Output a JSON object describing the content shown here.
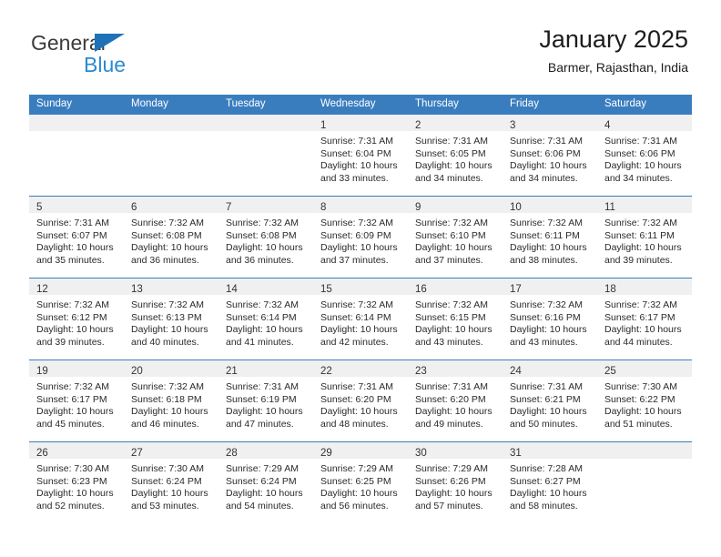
{
  "brand": {
    "line1": "General",
    "line2": "Blue",
    "line1_color": "#3b3b3b",
    "line2_color": "#2b8ad1",
    "triangle_color": "#1f72b8"
  },
  "header": {
    "title": "January 2025",
    "subtitle": "Barmer, Rajasthan, India"
  },
  "theme": {
    "header_blue": "#3a7dbf",
    "daynum_band": "#f0f0f0",
    "cell_bg": "#ffffff",
    "text": "#2a2a2a"
  },
  "weekdays": [
    "Sunday",
    "Monday",
    "Tuesday",
    "Wednesday",
    "Thursday",
    "Friday",
    "Saturday"
  ],
  "weeks": [
    [
      {
        "day": "",
        "sunrise": "",
        "sunset": "",
        "daylight_1": "",
        "daylight_2": ""
      },
      {
        "day": "",
        "sunrise": "",
        "sunset": "",
        "daylight_1": "",
        "daylight_2": ""
      },
      {
        "day": "",
        "sunrise": "",
        "sunset": "",
        "daylight_1": "",
        "daylight_2": ""
      },
      {
        "day": "1",
        "sunrise": "Sunrise: 7:31 AM",
        "sunset": "Sunset: 6:04 PM",
        "daylight_1": "Daylight: 10 hours",
        "daylight_2": "and 33 minutes."
      },
      {
        "day": "2",
        "sunrise": "Sunrise: 7:31 AM",
        "sunset": "Sunset: 6:05 PM",
        "daylight_1": "Daylight: 10 hours",
        "daylight_2": "and 34 minutes."
      },
      {
        "day": "3",
        "sunrise": "Sunrise: 7:31 AM",
        "sunset": "Sunset: 6:06 PM",
        "daylight_1": "Daylight: 10 hours",
        "daylight_2": "and 34 minutes."
      },
      {
        "day": "4",
        "sunrise": "Sunrise: 7:31 AM",
        "sunset": "Sunset: 6:06 PM",
        "daylight_1": "Daylight: 10 hours",
        "daylight_2": "and 34 minutes."
      }
    ],
    [
      {
        "day": "5",
        "sunrise": "Sunrise: 7:31 AM",
        "sunset": "Sunset: 6:07 PM",
        "daylight_1": "Daylight: 10 hours",
        "daylight_2": "and 35 minutes."
      },
      {
        "day": "6",
        "sunrise": "Sunrise: 7:32 AM",
        "sunset": "Sunset: 6:08 PM",
        "daylight_1": "Daylight: 10 hours",
        "daylight_2": "and 36 minutes."
      },
      {
        "day": "7",
        "sunrise": "Sunrise: 7:32 AM",
        "sunset": "Sunset: 6:08 PM",
        "daylight_1": "Daylight: 10 hours",
        "daylight_2": "and 36 minutes."
      },
      {
        "day": "8",
        "sunrise": "Sunrise: 7:32 AM",
        "sunset": "Sunset: 6:09 PM",
        "daylight_1": "Daylight: 10 hours",
        "daylight_2": "and 37 minutes."
      },
      {
        "day": "9",
        "sunrise": "Sunrise: 7:32 AM",
        "sunset": "Sunset: 6:10 PM",
        "daylight_1": "Daylight: 10 hours",
        "daylight_2": "and 37 minutes."
      },
      {
        "day": "10",
        "sunrise": "Sunrise: 7:32 AM",
        "sunset": "Sunset: 6:11 PM",
        "daylight_1": "Daylight: 10 hours",
        "daylight_2": "and 38 minutes."
      },
      {
        "day": "11",
        "sunrise": "Sunrise: 7:32 AM",
        "sunset": "Sunset: 6:11 PM",
        "daylight_1": "Daylight: 10 hours",
        "daylight_2": "and 39 minutes."
      }
    ],
    [
      {
        "day": "12",
        "sunrise": "Sunrise: 7:32 AM",
        "sunset": "Sunset: 6:12 PM",
        "daylight_1": "Daylight: 10 hours",
        "daylight_2": "and 39 minutes."
      },
      {
        "day": "13",
        "sunrise": "Sunrise: 7:32 AM",
        "sunset": "Sunset: 6:13 PM",
        "daylight_1": "Daylight: 10 hours",
        "daylight_2": "and 40 minutes."
      },
      {
        "day": "14",
        "sunrise": "Sunrise: 7:32 AM",
        "sunset": "Sunset: 6:14 PM",
        "daylight_1": "Daylight: 10 hours",
        "daylight_2": "and 41 minutes."
      },
      {
        "day": "15",
        "sunrise": "Sunrise: 7:32 AM",
        "sunset": "Sunset: 6:14 PM",
        "daylight_1": "Daylight: 10 hours",
        "daylight_2": "and 42 minutes."
      },
      {
        "day": "16",
        "sunrise": "Sunrise: 7:32 AM",
        "sunset": "Sunset: 6:15 PM",
        "daylight_1": "Daylight: 10 hours",
        "daylight_2": "and 43 minutes."
      },
      {
        "day": "17",
        "sunrise": "Sunrise: 7:32 AM",
        "sunset": "Sunset: 6:16 PM",
        "daylight_1": "Daylight: 10 hours",
        "daylight_2": "and 43 minutes."
      },
      {
        "day": "18",
        "sunrise": "Sunrise: 7:32 AM",
        "sunset": "Sunset: 6:17 PM",
        "daylight_1": "Daylight: 10 hours",
        "daylight_2": "and 44 minutes."
      }
    ],
    [
      {
        "day": "19",
        "sunrise": "Sunrise: 7:32 AM",
        "sunset": "Sunset: 6:17 PM",
        "daylight_1": "Daylight: 10 hours",
        "daylight_2": "and 45 minutes."
      },
      {
        "day": "20",
        "sunrise": "Sunrise: 7:32 AM",
        "sunset": "Sunset: 6:18 PM",
        "daylight_1": "Daylight: 10 hours",
        "daylight_2": "and 46 minutes."
      },
      {
        "day": "21",
        "sunrise": "Sunrise: 7:31 AM",
        "sunset": "Sunset: 6:19 PM",
        "daylight_1": "Daylight: 10 hours",
        "daylight_2": "and 47 minutes."
      },
      {
        "day": "22",
        "sunrise": "Sunrise: 7:31 AM",
        "sunset": "Sunset: 6:20 PM",
        "daylight_1": "Daylight: 10 hours",
        "daylight_2": "and 48 minutes."
      },
      {
        "day": "23",
        "sunrise": "Sunrise: 7:31 AM",
        "sunset": "Sunset: 6:20 PM",
        "daylight_1": "Daylight: 10 hours",
        "daylight_2": "and 49 minutes."
      },
      {
        "day": "24",
        "sunrise": "Sunrise: 7:31 AM",
        "sunset": "Sunset: 6:21 PM",
        "daylight_1": "Daylight: 10 hours",
        "daylight_2": "and 50 minutes."
      },
      {
        "day": "25",
        "sunrise": "Sunrise: 7:30 AM",
        "sunset": "Sunset: 6:22 PM",
        "daylight_1": "Daylight: 10 hours",
        "daylight_2": "and 51 minutes."
      }
    ],
    [
      {
        "day": "26",
        "sunrise": "Sunrise: 7:30 AM",
        "sunset": "Sunset: 6:23 PM",
        "daylight_1": "Daylight: 10 hours",
        "daylight_2": "and 52 minutes."
      },
      {
        "day": "27",
        "sunrise": "Sunrise: 7:30 AM",
        "sunset": "Sunset: 6:24 PM",
        "daylight_1": "Daylight: 10 hours",
        "daylight_2": "and 53 minutes."
      },
      {
        "day": "28",
        "sunrise": "Sunrise: 7:29 AM",
        "sunset": "Sunset: 6:24 PM",
        "daylight_1": "Daylight: 10 hours",
        "daylight_2": "and 54 minutes."
      },
      {
        "day": "29",
        "sunrise": "Sunrise: 7:29 AM",
        "sunset": "Sunset: 6:25 PM",
        "daylight_1": "Daylight: 10 hours",
        "daylight_2": "and 56 minutes."
      },
      {
        "day": "30",
        "sunrise": "Sunrise: 7:29 AM",
        "sunset": "Sunset: 6:26 PM",
        "daylight_1": "Daylight: 10 hours",
        "daylight_2": "and 57 minutes."
      },
      {
        "day": "31",
        "sunrise": "Sunrise: 7:28 AM",
        "sunset": "Sunset: 6:27 PM",
        "daylight_1": "Daylight: 10 hours",
        "daylight_2": "and 58 minutes."
      },
      {
        "day": "",
        "sunrise": "",
        "sunset": "",
        "daylight_1": "",
        "daylight_2": ""
      }
    ]
  ]
}
